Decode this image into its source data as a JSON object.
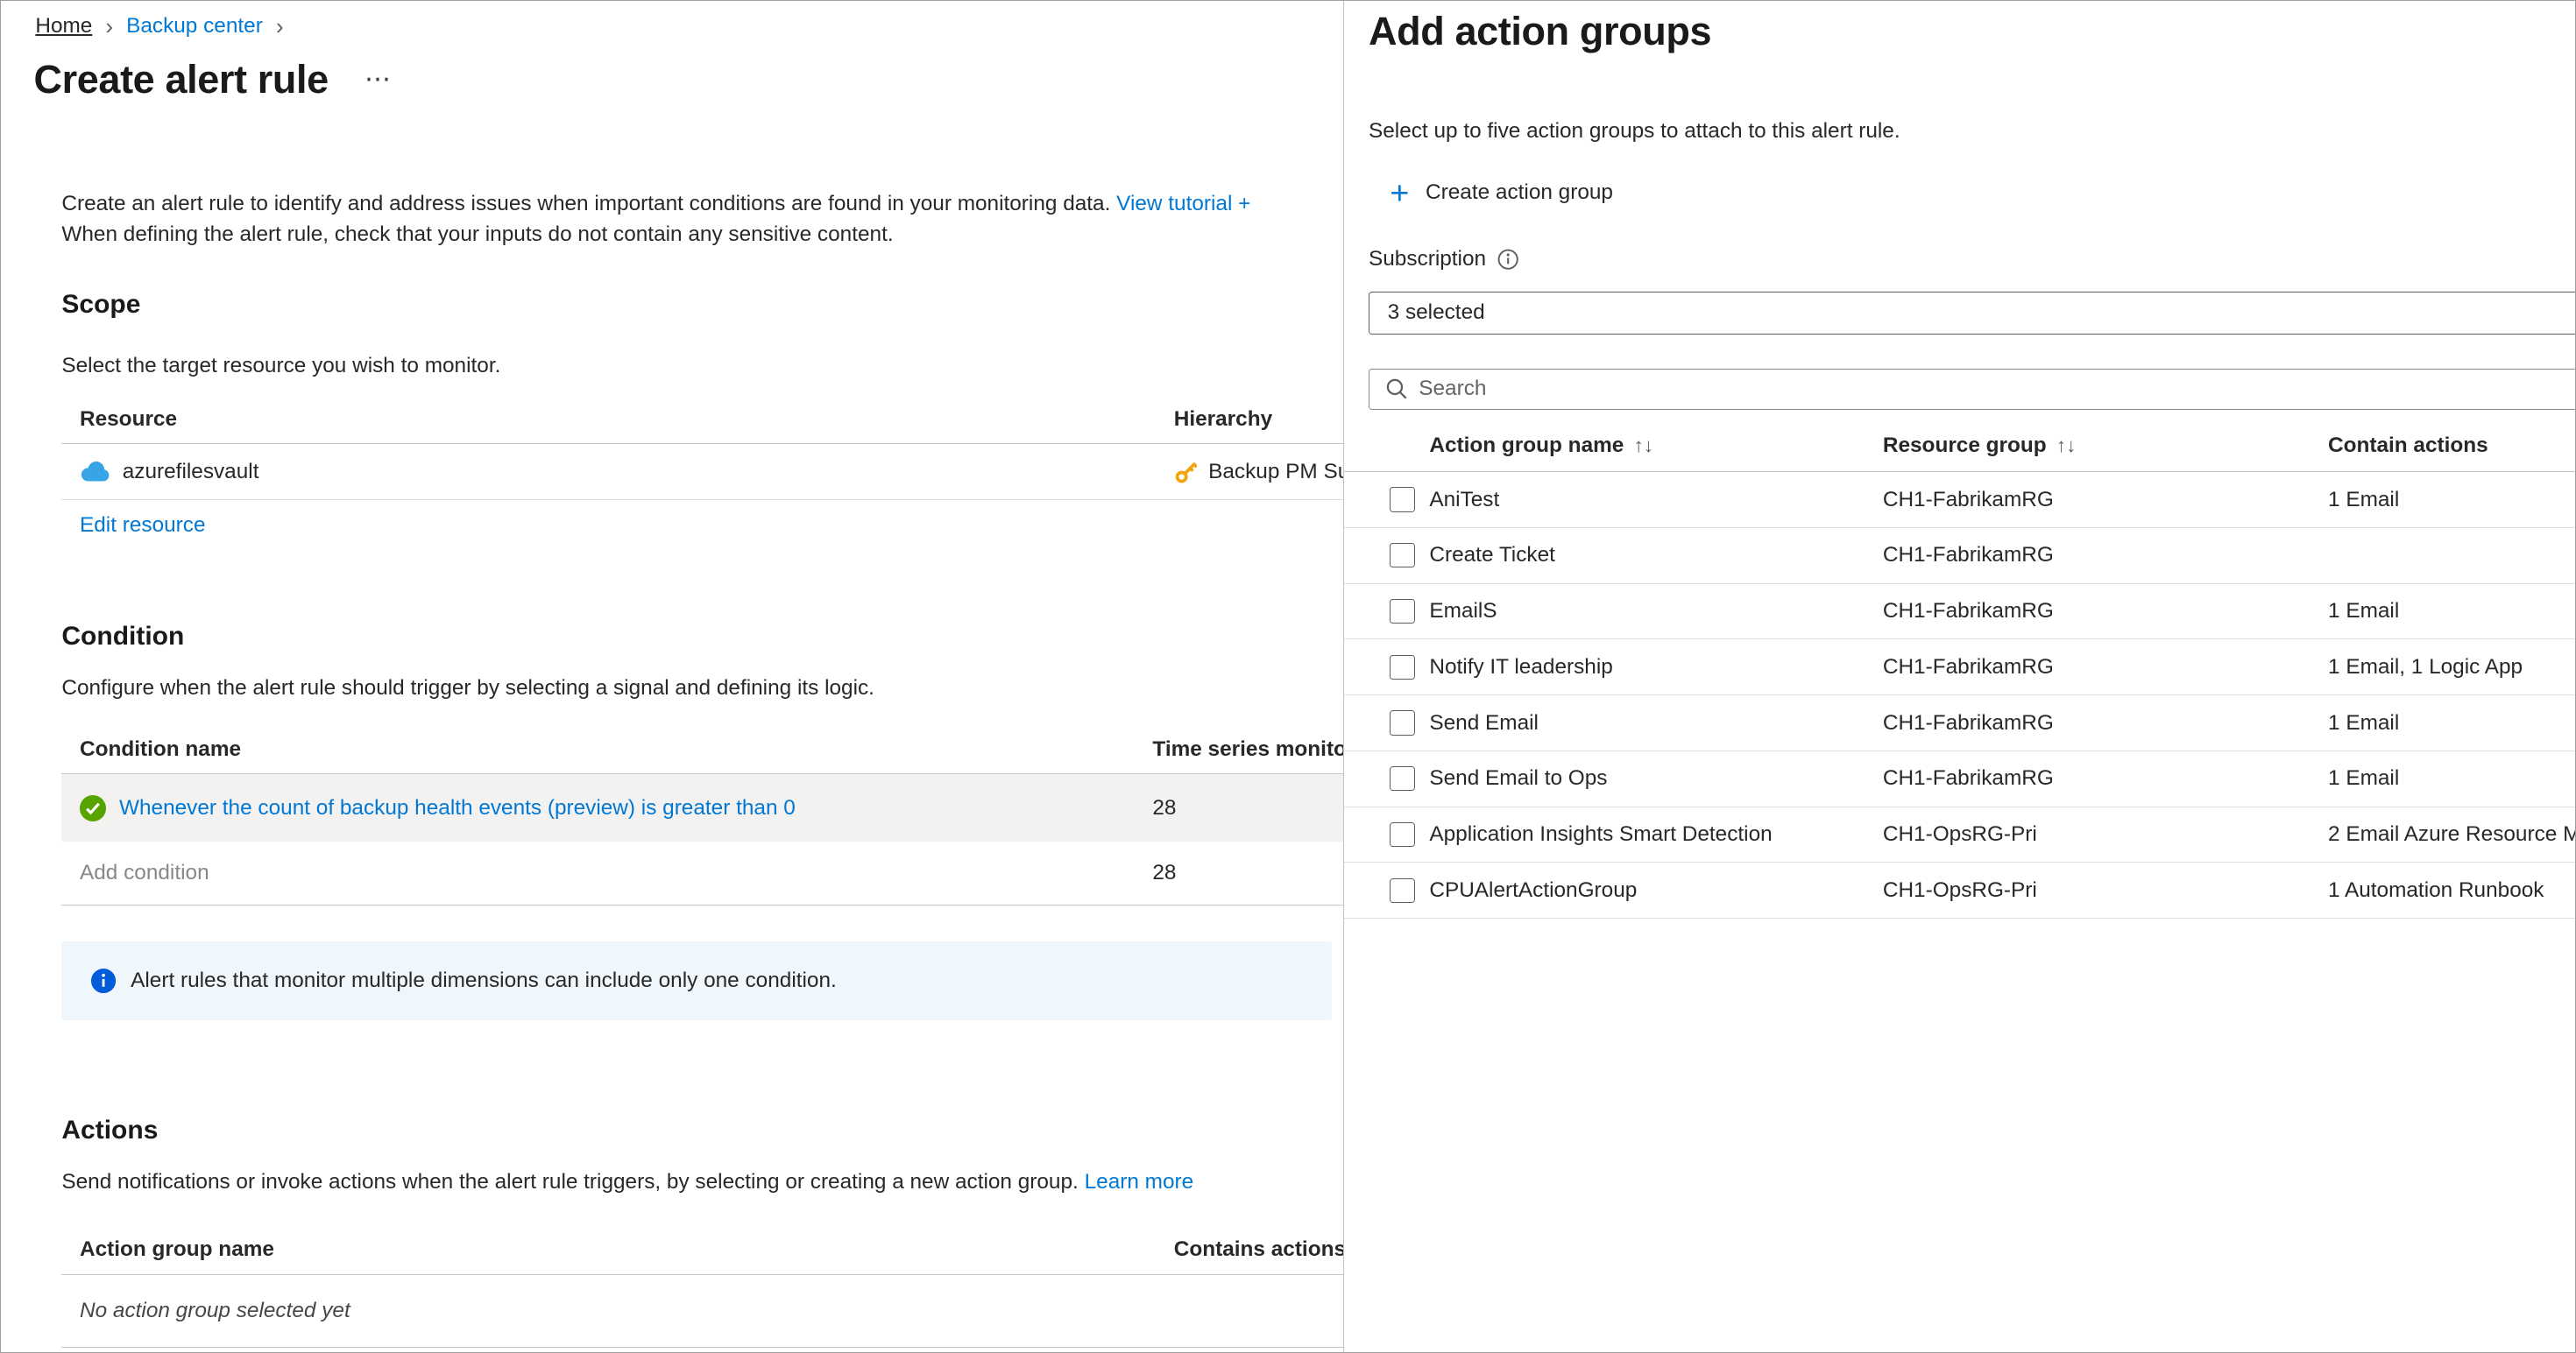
{
  "colors": {
    "accent": "#0078d4",
    "text": "#292827",
    "info-bg": "#eff6fc",
    "row-highlight": "#f3f2f1",
    "success": "#57a300",
    "info-icon": "#015cda",
    "key-icon": "#f2a60d",
    "cloud-icon": "#37a5e5"
  },
  "icons": {
    "breadcrumb_separator": "›",
    "menu": "⋯",
    "plus": "+",
    "sort": "↑↓"
  },
  "breadcrumb": {
    "items": [
      {
        "label": "Home"
      },
      {
        "label": "Backup center"
      }
    ]
  },
  "header": {
    "title": "Create alert rule"
  },
  "intro": {
    "line1": "Create an alert rule to identify and address issues when important conditions are found in your monitoring data.",
    "tutorial_link": "View tutorial +",
    "line2": "When defining the alert rule, check that your inputs do not contain any sensitive content."
  },
  "scope": {
    "heading": "Scope",
    "description": "Select the target resource you wish to monitor.",
    "columns": {
      "resource": "Resource",
      "hierarchy": "Hierarchy"
    },
    "row": {
      "resource": "azurefilesvault",
      "hierarchy": "Backup PM Su"
    },
    "edit_link": "Edit resource"
  },
  "condition": {
    "heading": "Condition",
    "description": "Configure when the alert rule should trigger by selecting a signal and defining its logic.",
    "columns": {
      "name": "Condition name",
      "monitor": "Time series monitoring"
    },
    "rows": [
      {
        "name": "Whenever the count of backup health events (preview) is greater than 0",
        "count": "28"
      },
      {
        "name": "Add condition",
        "count": "28"
      }
    ],
    "info": "Alert rules that monitor multiple dimensions can include only one condition."
  },
  "actions": {
    "heading": "Actions",
    "description": "Send notifications or invoke actions when the alert rule triggers, by selecting or creating a new action group.",
    "learn_more": "Learn more",
    "columns": {
      "name": "Action group name",
      "contains": "Contains actions"
    },
    "empty": "No action group selected yet"
  },
  "panel": {
    "title": "Add action groups",
    "description": "Select up to five action groups to attach to this alert rule.",
    "create_label": "Create action group",
    "subscription": {
      "label": "Subscription",
      "value": "3 selected"
    },
    "search_placeholder": "Search",
    "columns": {
      "name": "Action group name",
      "resource_group": "Resource group",
      "actions": "Contain actions"
    },
    "rows": [
      {
        "name": "AniTest",
        "resource_group": "CH1-FabrikamRG",
        "actions": "1 Email"
      },
      {
        "name": "Create Ticket",
        "resource_group": "CH1-FabrikamRG",
        "actions": ""
      },
      {
        "name": "EmailS",
        "resource_group": "CH1-FabrikamRG",
        "actions": "1 Email"
      },
      {
        "name": "Notify IT leadership",
        "resource_group": "CH1-FabrikamRG",
        "actions": "1 Email, 1 Logic App"
      },
      {
        "name": "Send Email",
        "resource_group": "CH1-FabrikamRG",
        "actions": "1 Email"
      },
      {
        "name": "Send Email to Ops",
        "resource_group": "CH1-FabrikamRG",
        "actions": "1 Email"
      },
      {
        "name": "Application Insights Smart Detection",
        "resource_group": "CH1-OpsRG-Pri",
        "actions": "2 Email Azure Resource M"
      },
      {
        "name": "CPUAlertActionGroup",
        "resource_group": "CH1-OpsRG-Pri",
        "actions": "1 Automation Runbook"
      }
    ]
  }
}
